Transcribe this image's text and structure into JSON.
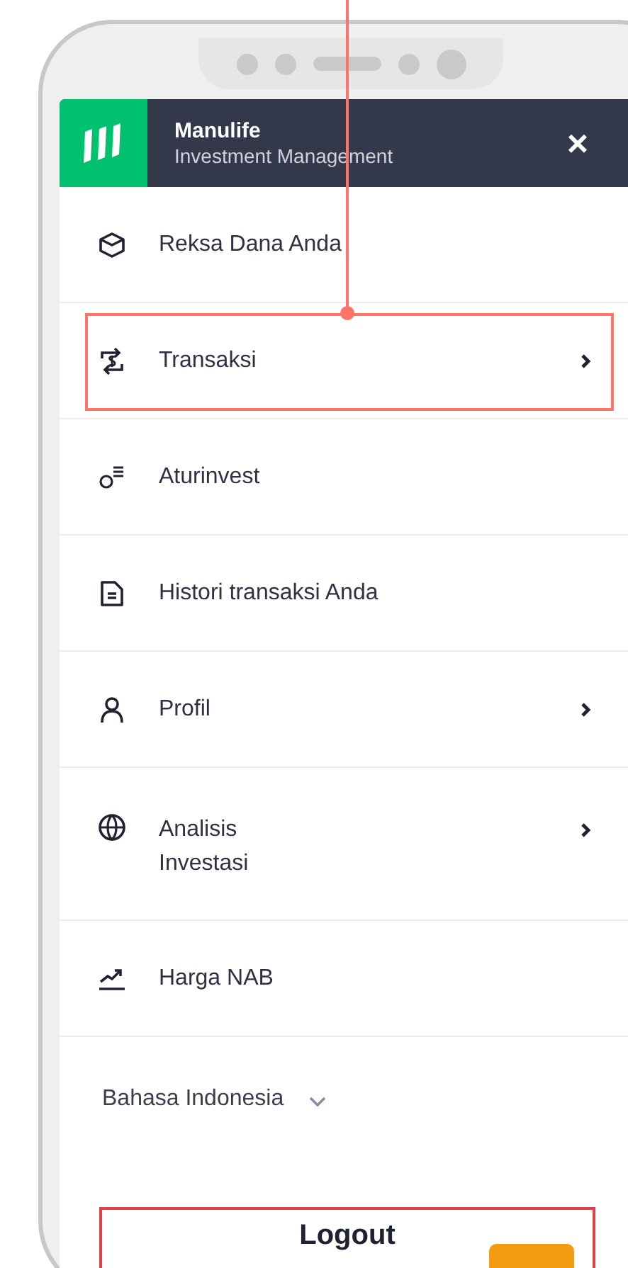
{
  "header": {
    "brand": "Manulife",
    "subtitle": "Investment Management",
    "close": "×"
  },
  "menu": [
    {
      "label": "Reksa Dana Anda",
      "has_arrow": false,
      "highlighted": false
    },
    {
      "label": "Transaksi",
      "has_arrow": true,
      "highlighted": true
    },
    {
      "label": "Aturinvest",
      "has_arrow": false,
      "highlighted": false
    },
    {
      "label": "Histori transaksi Anda",
      "has_arrow": false,
      "highlighted": false
    },
    {
      "label": "Profil",
      "has_arrow": true,
      "highlighted": false
    },
    {
      "label": "Analisis\nInvestasi",
      "has_arrow": true,
      "highlighted": false
    },
    {
      "label": "Harga NAB",
      "has_arrow": false,
      "highlighted": false
    }
  ],
  "language": {
    "value": "Bahasa Indonesia"
  },
  "logout": {
    "label": "Logout"
  }
}
